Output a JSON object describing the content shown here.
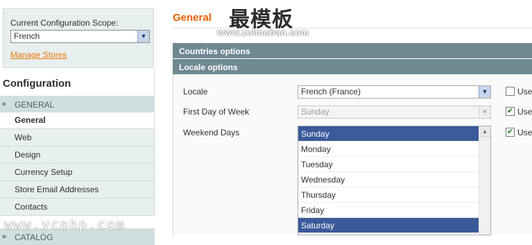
{
  "sidebar": {
    "scope_label": "Current Configuration Scope:",
    "scope_value": "French",
    "manage_stores": "Manage Stores",
    "config_title": "Configuration",
    "group_general": "GENERAL",
    "group_catalog": "CATALOG",
    "items": [
      {
        "label": "General",
        "active": true
      },
      {
        "label": "Web"
      },
      {
        "label": "Design"
      },
      {
        "label": "Currency Setup"
      },
      {
        "label": "Store Email Addresses"
      },
      {
        "label": "Contacts"
      }
    ]
  },
  "main": {
    "title": "General",
    "sections": {
      "countries": "Countries options",
      "locale": "Locale options"
    },
    "fields": {
      "locale": {
        "label": "Locale",
        "value": "French (France)",
        "use_default": false
      },
      "first_day": {
        "label": "First Day of Week",
        "value": "Sunday",
        "use_default": true
      },
      "weekend": {
        "label": "Weekend Days",
        "options": [
          "Sunday",
          "Monday",
          "Tuesday",
          "Wednesday",
          "Thursday",
          "Friday",
          "Saturday"
        ],
        "selected": [
          "Sunday",
          "Saturday"
        ],
        "use_default": true
      }
    },
    "use_label": "Use"
  },
  "watermarks": {
    "big": "最模板",
    "url": "www.zuimoban.com",
    "bottom": "www.ycphp.com"
  },
  "colors": {
    "accent_orange": "#eb5e00",
    "section_bar": "#6f8992",
    "selection_blue": "#3a5a9a",
    "sidebar_bg": "#e7efef"
  }
}
